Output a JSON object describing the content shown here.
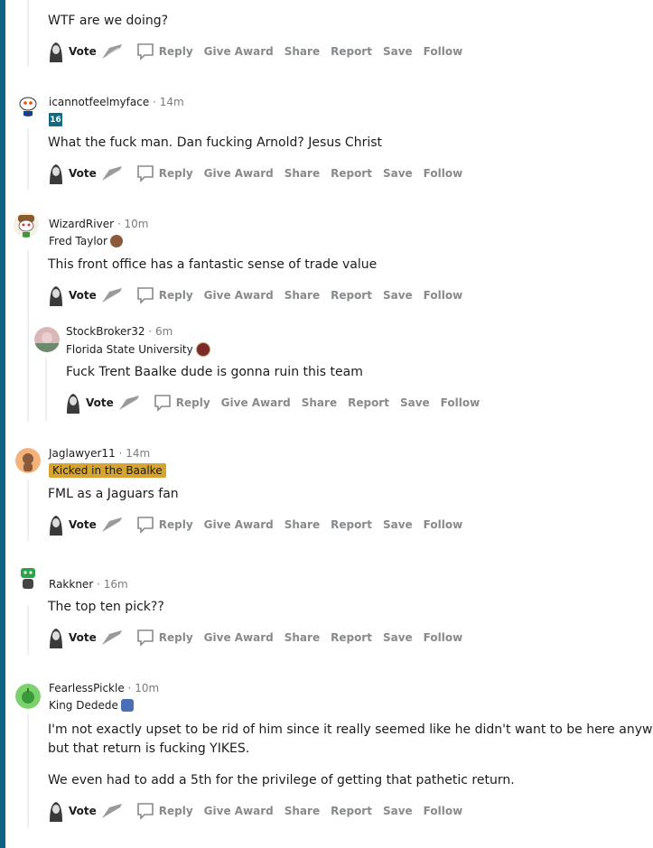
{
  "actions": {
    "vote": "Vote",
    "reply": "Reply",
    "give_award": "Give Award",
    "share": "Share",
    "report": "Report",
    "save": "Save",
    "follow": "Follow"
  },
  "comments": [
    {
      "body": [
        "WTF are we doing?"
      ]
    },
    {
      "author": "icannotfeelmyface",
      "time": "14m",
      "flair_badge": "16",
      "body": [
        "What the fuck man. Dan fucking Arnold? Jesus Christ"
      ]
    },
    {
      "author": "WizardRiver",
      "time": "10m",
      "flair": "Fred Taylor",
      "body": [
        "This front office has a fantastic sense of trade value"
      ]
    },
    {
      "author": "StockBroker32",
      "time": "6m",
      "flair": "Florida State University",
      "body": [
        "Fuck Trent Baalke dude is gonna ruin this team"
      ]
    },
    {
      "author": "Jaglawyer11",
      "time": "14m",
      "flair": "Kicked in the Baalke",
      "body": [
        "FML as a Jaguars fan"
      ]
    },
    {
      "author": "Rakkner",
      "time": "16m",
      "body": [
        "The top ten pick??"
      ]
    },
    {
      "author": "FearlessPickle",
      "time": "10m",
      "flair": "King Dedede",
      "body": [
        "I'm not exactly upset to be rid of him since it really seemed like he didn't want to be here anyway,",
        "but that return is fucking YIKES.",
        "We even had to add a 5th for the privilege of getting that pathetic return."
      ]
    }
  ],
  "separator": "·",
  "colors": {
    "left_bar": "#0d6284",
    "flair_badge": "#d6a531",
    "action_gray": "#878a8c"
  }
}
